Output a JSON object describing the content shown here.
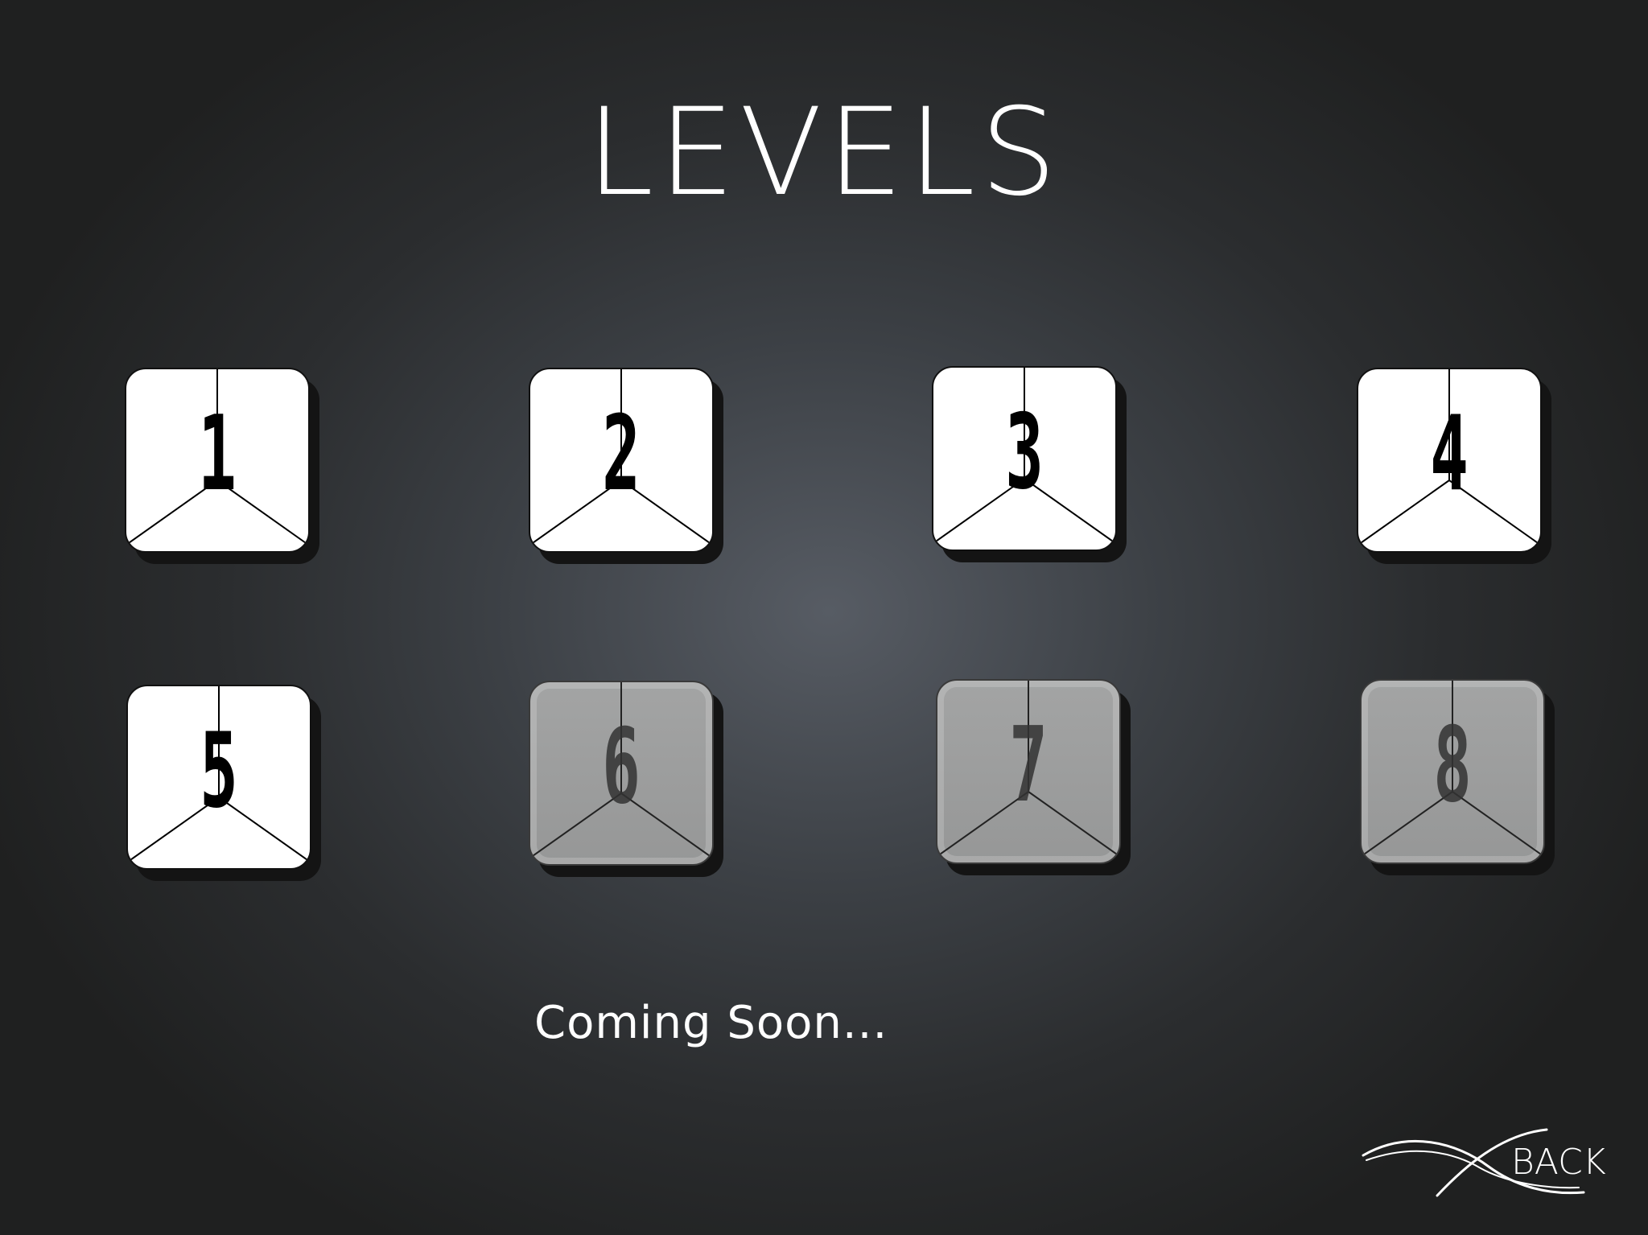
{
  "title": "LEVELS",
  "levels": [
    {
      "label": "1",
      "locked": false
    },
    {
      "label": "2",
      "locked": false
    },
    {
      "label": "3",
      "locked": false
    },
    {
      "label": "4",
      "locked": false
    },
    {
      "label": "5",
      "locked": false
    },
    {
      "label": "6",
      "locked": true
    },
    {
      "label": "7",
      "locked": true
    },
    {
      "label": "8",
      "locked": true
    }
  ],
  "coming_soon": "Coming Soon...",
  "back_label": "BACK",
  "colors": {
    "tile_unlocked": "#ffffff",
    "tile_locked": "#9c9d9d",
    "text": "#ffffff"
  }
}
